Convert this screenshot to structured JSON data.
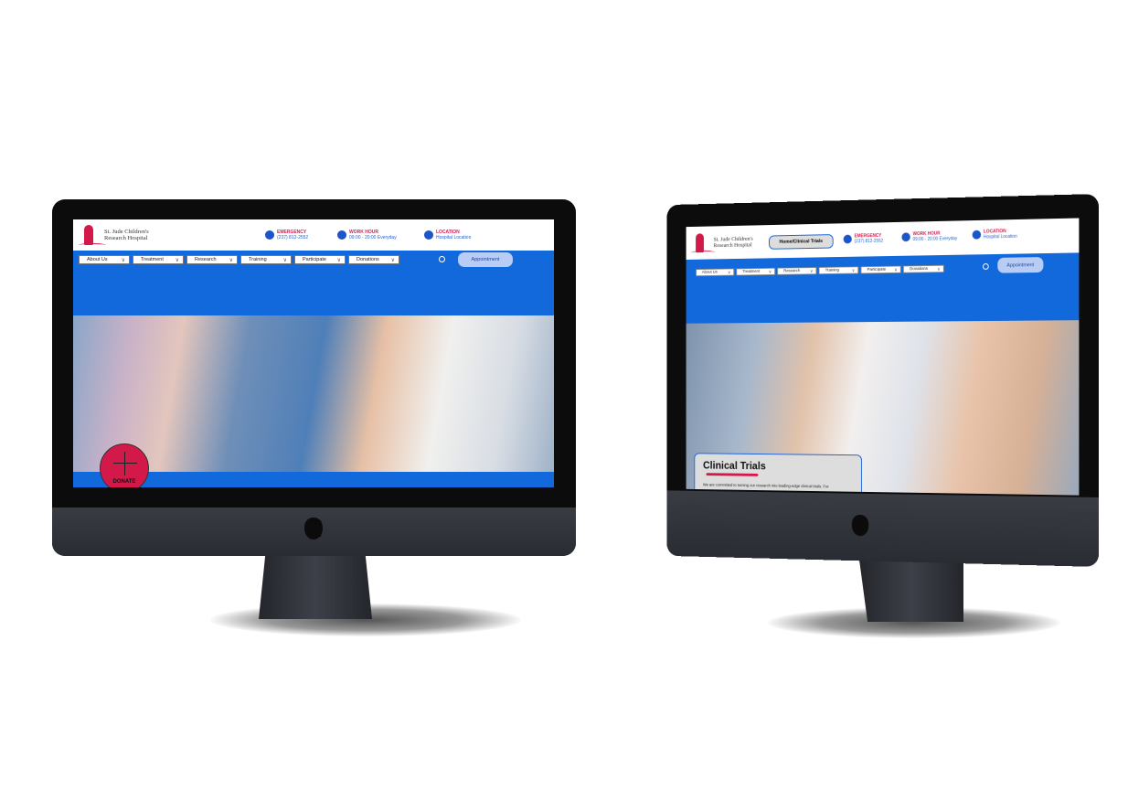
{
  "site": {
    "logo_line1": "St. Jude Children's",
    "logo_line2": "Research Hospital"
  },
  "info": [
    {
      "title": "EMERGENCY",
      "value": "(237) 812-2552",
      "icon": "phone-icon"
    },
    {
      "title": "WORK HOUR",
      "value": "09:00 - 20:00 Everyday",
      "icon": "clock-icon"
    },
    {
      "title": "LOCATION",
      "value": "Hospital Location",
      "icon": "location-pin-icon"
    }
  ],
  "nav": [
    "About Us",
    "Treatment",
    "Research",
    "Training",
    "Participate",
    "Donations"
  ],
  "appointment": "Appointment",
  "donate": "DONATE",
  "breadcrumb": "Home/Clinical Trials",
  "clinical": {
    "title": "Clinical Trials",
    "text": "We are committed to turning our research into leading-edge clinical trials. For"
  },
  "colors": {
    "brand_blue": "#1269db",
    "brand_red": "#d3184a"
  }
}
